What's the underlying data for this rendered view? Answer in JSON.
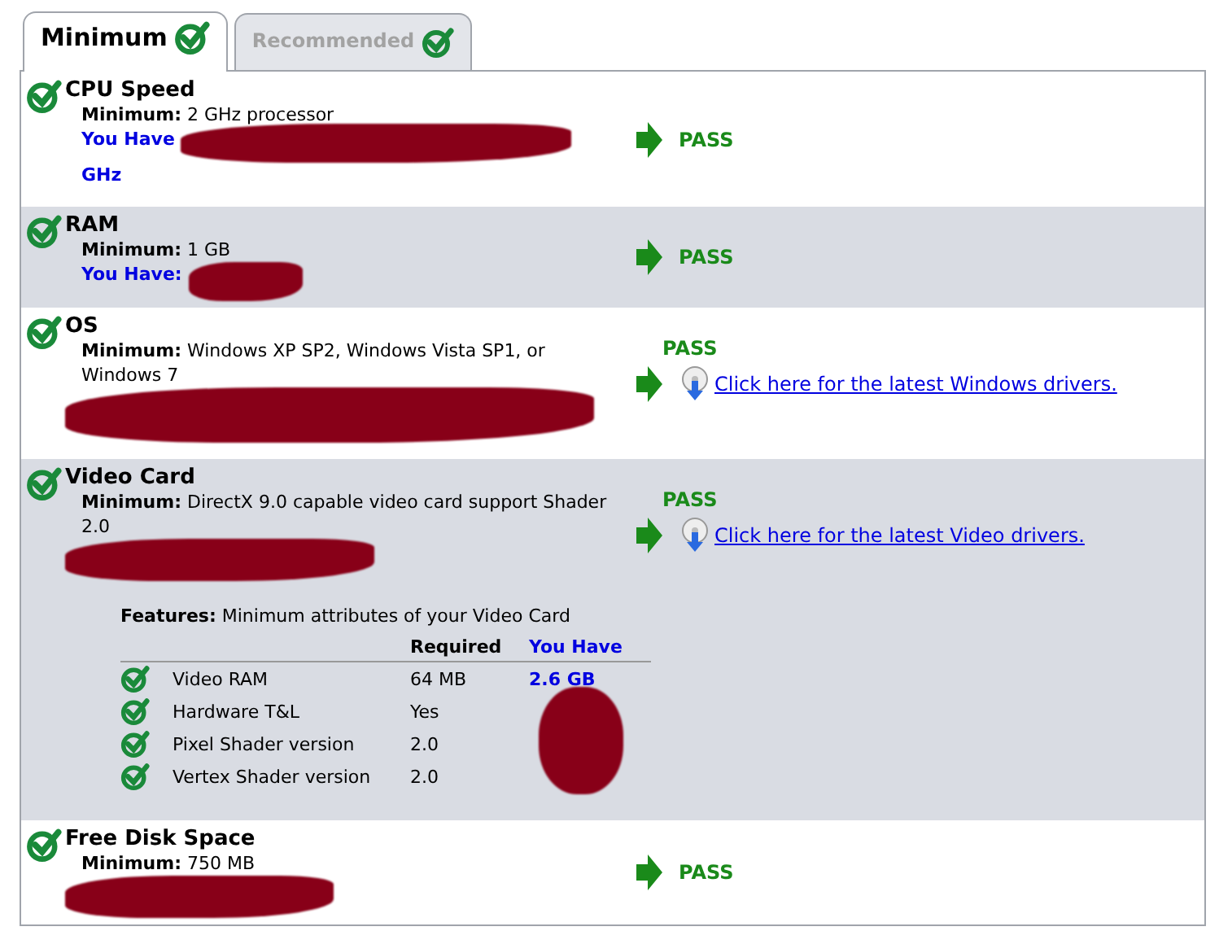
{
  "tabs": [
    {
      "label": "Minimum",
      "selected": true,
      "passed": true
    },
    {
      "label": "Recommended",
      "selected": false,
      "passed": true
    }
  ],
  "checks": [
    {
      "title": "CPU Speed",
      "passed": true,
      "minimum_label": "Minimum:",
      "minimum": "2 GHz processor",
      "you_have": "You Have",
      "you_have_suffix": "GHz",
      "redacted": true,
      "status": "PASS"
    },
    {
      "title": "RAM",
      "passed": true,
      "minimum_label": "Minimum:",
      "minimum": "1 GB",
      "you_have": "You Have:",
      "redacted": true,
      "status": "PASS"
    },
    {
      "title": "OS",
      "passed": true,
      "minimum_label": "Minimum:",
      "minimum": "Windows XP SP2, Windows Vista SP1, or Windows 7",
      "redacted": true,
      "status": "PASS",
      "link": "Click here for the latest Windows drivers."
    },
    {
      "title": "Video Card",
      "passed": true,
      "minimum_label": "Minimum:",
      "minimum": "DirectX 9.0 capable video card support Shader 2.0",
      "redacted": true,
      "status": "PASS",
      "link": "Click here for the latest Video drivers.",
      "features": {
        "label": "Features:",
        "text": "Minimum attributes of your Video Card",
        "columns": [
          "Required",
          "You Have"
        ],
        "rows": [
          {
            "name": "Video RAM",
            "required": "64 MB",
            "you_have": "2.6 GB",
            "passed": true
          },
          {
            "name": "Hardware T&L",
            "required": "Yes",
            "passed": true
          },
          {
            "name": "Pixel Shader version",
            "required": "2.0",
            "passed": true
          },
          {
            "name": "Vertex Shader version",
            "required": "2.0",
            "passed": true
          }
        ]
      }
    },
    {
      "title": "Free Disk Space",
      "passed": true,
      "minimum_label": "Minimum:",
      "minimum": "750 MB",
      "redacted": true,
      "status": "PASS"
    }
  ]
}
